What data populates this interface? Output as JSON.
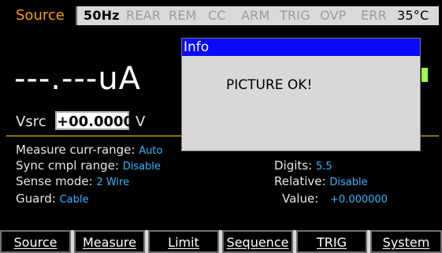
{
  "status_bar": {
    "source_label": "Source",
    "items": [
      {
        "label": "50Hz",
        "active": true
      },
      {
        "label": "REAR",
        "active": false
      },
      {
        "label": "REM",
        "active": false
      },
      {
        "label": "CC",
        "active": false
      },
      {
        "label": "ARM",
        "active": false
      },
      {
        "label": "TRIG",
        "active": false
      },
      {
        "label": "OVP",
        "active": false
      },
      {
        "label": "ERR",
        "active": false
      }
    ],
    "temperature": "35°C"
  },
  "readout": {
    "value": "---.---uA"
  },
  "vsrc": {
    "label": "Vsrc",
    "value": "+00.0000",
    "unit": "V"
  },
  "params": {
    "measure_curr_range": {
      "label": "Measure curr-range:",
      "value": "Auto"
    },
    "sync_cmpl_range": {
      "label": "Sync cmpl range:",
      "value": "Disable"
    },
    "sense_mode": {
      "label": "Sense mode:",
      "value": "2 Wire"
    },
    "guard": {
      "label": "Guard:",
      "value": "Cable"
    },
    "digits": {
      "label": "Digits:",
      "value": "5.5"
    },
    "relative": {
      "label": "Relative:",
      "value": "Disable"
    },
    "value": {
      "label": "Value:",
      "value": "+0.000000"
    }
  },
  "dialog": {
    "title": "Info",
    "message": "PICTURE OK!"
  },
  "bottom_tabs": [
    "Source",
    "Measure",
    "Limit",
    "Sequence",
    "TRIG",
    "System"
  ],
  "colors": {
    "accent_orange": "#ff9b00",
    "value_blue": "#33b6ff",
    "divider_yellow": "#ffd400",
    "dialog_blue": "#0a0aff",
    "indicator_green": "#9cff4a"
  }
}
